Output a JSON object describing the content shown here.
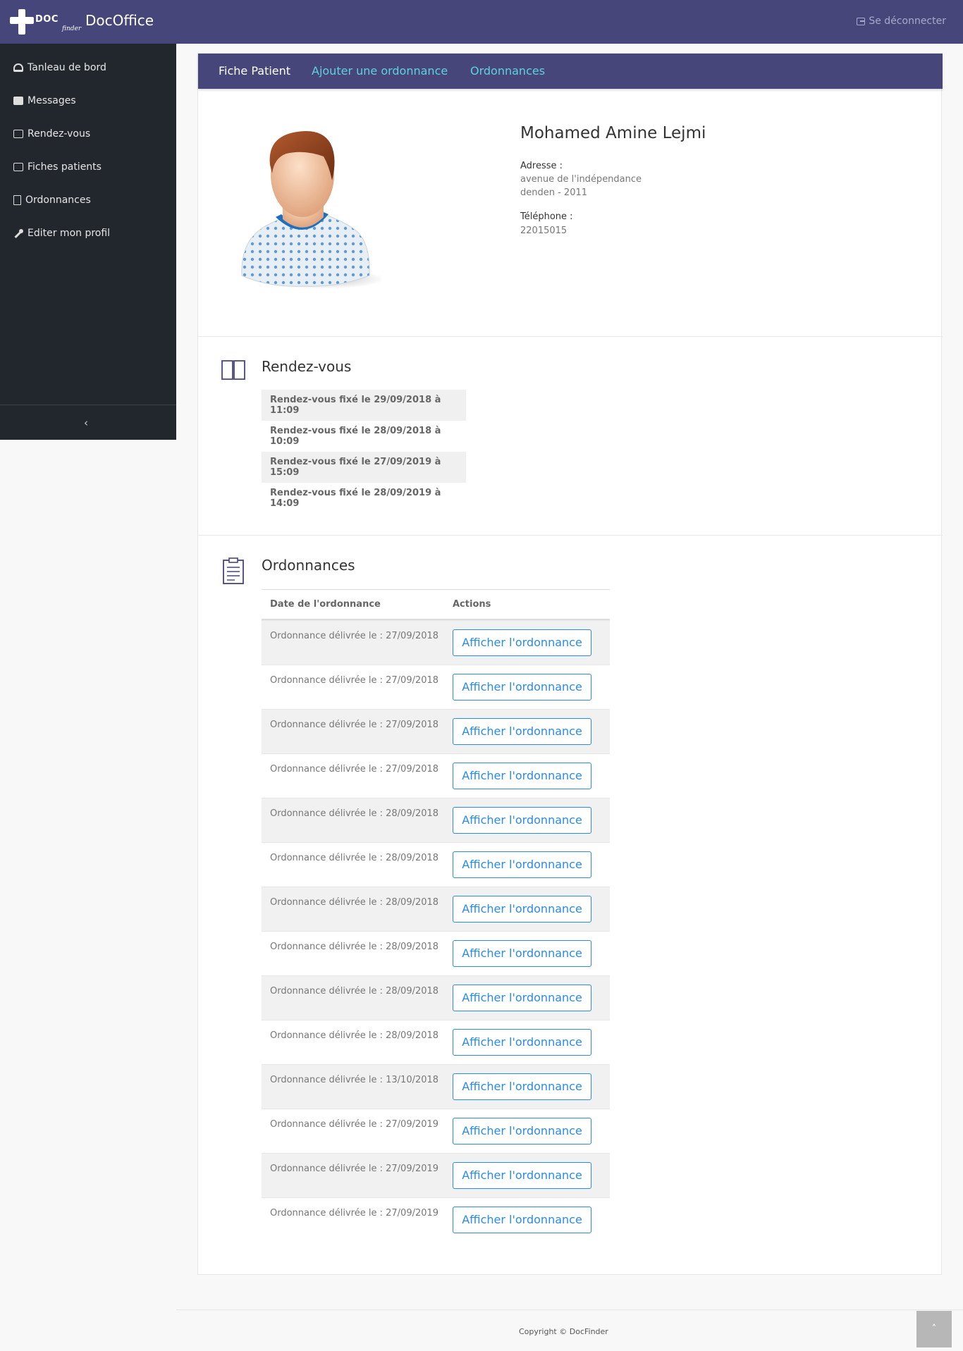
{
  "header": {
    "logo_text": "DOC",
    "logo_subtext": "finder",
    "app_title": "DocOffice",
    "logout_label": "Se déconnecter"
  },
  "sidebar": {
    "items": [
      {
        "label": "Tanleau de bord",
        "icon": "dashboard-icon"
      },
      {
        "label": "Messages",
        "icon": "envelope-icon"
      },
      {
        "label": "Rendez-vous",
        "icon": "calendar-icon"
      },
      {
        "label": "Fiches patients",
        "icon": "id-card-icon"
      },
      {
        "label": "Ordonnances",
        "icon": "file-icon"
      },
      {
        "label": "Editer mon profil",
        "icon": "wrench-icon"
      }
    ],
    "collapse_glyph": "‹"
  },
  "tabs": [
    "Fiche Patient",
    "Ajouter une ordonnance",
    "Ordonnances"
  ],
  "patient": {
    "name": "Mohamed Amine Lejmi",
    "address_label": "Adresse :",
    "address_line1": "avenue de l'indépendance",
    "address_line2": "denden - 2011",
    "phone_label": "Téléphone :",
    "phone": "22015015"
  },
  "appointments": {
    "title": "Rendez-vous",
    "items": [
      "Rendez-vous fixé le 29/09/2018 à 11:09",
      "Rendez-vous fixé le 28/09/2018 à 10:09",
      "Rendez-vous fixé le 27/09/2019 à 15:09",
      "Rendez-vous fixé le 28/09/2019 à 14:09"
    ]
  },
  "prescriptions": {
    "title": "Ordonnances",
    "col_date": "Date de l'ordonnance",
    "col_actions": "Actions",
    "button_label": "Afficher l'ordonnance",
    "rows": [
      "Ordonnance délivrée le : 27/09/2018",
      "Ordonnance délivrée le : 27/09/2018",
      "Ordonnance délivrée le : 27/09/2018",
      "Ordonnance délivrée le : 27/09/2018",
      "Ordonnance délivrée le : 28/09/2018",
      "Ordonnance délivrée le : 28/09/2018",
      "Ordonnance délivrée le : 28/09/2018",
      "Ordonnance délivrée le : 28/09/2018",
      "Ordonnance délivrée le : 28/09/2018",
      "Ordonnance délivrée le : 28/09/2018",
      "Ordonnance délivrée le : 13/10/2018",
      "Ordonnance délivrée le : 27/09/2019",
      "Ordonnance délivrée le : 27/09/2019",
      "Ordonnance délivrée le : 27/09/2019"
    ]
  },
  "footer": {
    "copyright": "Copyright © DocFinder",
    "scroll_top_glyph": "˄"
  },
  "colors": {
    "topbar": "#46467a",
    "sidebar": "#22272e",
    "tab_link": "#5fd2dc",
    "button_accent": "#2a8be6"
  }
}
